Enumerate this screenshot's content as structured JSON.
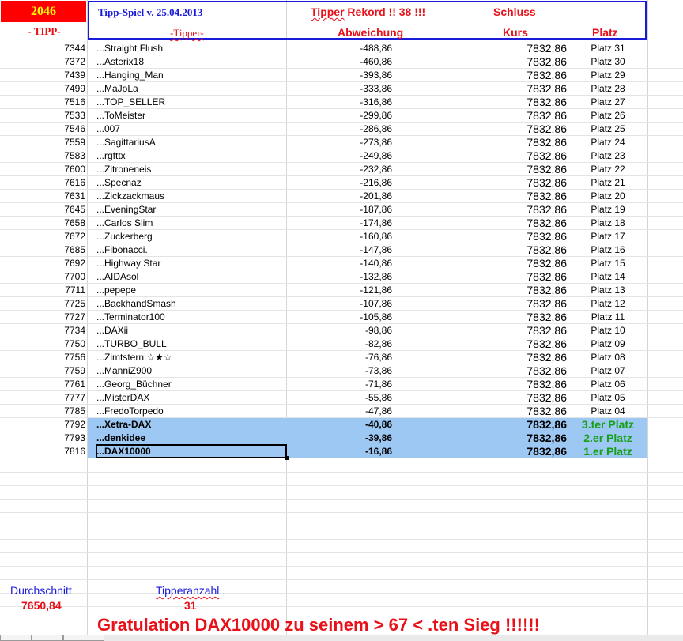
{
  "header": {
    "year": "2046",
    "title": "Tipp-Spiel v. 25.04.2013",
    "rekord_word": "Tipper",
    "rekord_rest": " Rekord !!  38  !!!",
    "schluss": "Schluss",
    "col_tipp": "- TIPP-",
    "col_tipper": "-Tipper-",
    "col_abweichung": "Abweichung",
    "col_kurs": "Kurs",
    "col_platz": "Platz"
  },
  "rows": [
    {
      "tipp": "7344",
      "name": "...Straight Flush",
      "abw": "-488,86",
      "kurs": "7832,86",
      "platz": "Platz 31"
    },
    {
      "tipp": "7372",
      "name": "...Asterix18",
      "abw": "-460,86",
      "kurs": "7832,86",
      "platz": "Platz 30"
    },
    {
      "tipp": "7439",
      "name": "...Hanging_Man",
      "abw": "-393,86",
      "kurs": "7832,86",
      "platz": "Platz 29"
    },
    {
      "tipp": "7499",
      "name": "...MaJoLa",
      "abw": "-333,86",
      "kurs": "7832,86",
      "platz": "Platz 28"
    },
    {
      "tipp": "7516",
      "name": "...TOP_SELLER",
      "abw": "-316,86",
      "kurs": "7832,86",
      "platz": "Platz 27"
    },
    {
      "tipp": "7533",
      "name": "...ToMeister",
      "abw": "-299,86",
      "kurs": "7832,86",
      "platz": "Platz 26"
    },
    {
      "tipp": "7546",
      "name": "...007",
      "abw": "-286,86",
      "kurs": "7832,86",
      "platz": "Platz 25"
    },
    {
      "tipp": "7559",
      "name": "...SagittariusA",
      "abw": "-273,86",
      "kurs": "7832,86",
      "platz": "Platz 24"
    },
    {
      "tipp": "7583",
      "name": "...rgfttx",
      "abw": "-249,86",
      "kurs": "7832,86",
      "platz": "Platz 23"
    },
    {
      "tipp": "7600",
      "name": "...Zitroneneis",
      "abw": "-232,86",
      "kurs": "7832,86",
      "platz": "Platz 22"
    },
    {
      "tipp": "7616",
      "name": "...Specnaz",
      "abw": "-216,86",
      "kurs": "7832,86",
      "platz": "Platz 21"
    },
    {
      "tipp": "7631",
      "name": "...Zickzackmaus",
      "abw": "-201,86",
      "kurs": "7832,86",
      "platz": "Platz 20"
    },
    {
      "tipp": "7645",
      "name": "...EveningStar",
      "abw": "-187,86",
      "kurs": "7832,86",
      "platz": "Platz 19"
    },
    {
      "tipp": "7658",
      "name": "...Carlos Slim",
      "abw": "-174,86",
      "kurs": "7832,86",
      "platz": "Platz 18"
    },
    {
      "tipp": "7672",
      "name": "...Zuckerberg",
      "abw": "-160,86",
      "kurs": "7832,86",
      "platz": "Platz 17"
    },
    {
      "tipp": "7685",
      "name": "...Fibonacci.",
      "abw": "-147,86",
      "kurs": "7832,86",
      "platz": "Platz 16"
    },
    {
      "tipp": "7692",
      "name": "...Highway Star",
      "abw": "-140,86",
      "kurs": "7832,86",
      "platz": "Platz 15"
    },
    {
      "tipp": "7700",
      "name": "...AIDAsol",
      "abw": "-132,86",
      "kurs": "7832,86",
      "platz": "Platz 14"
    },
    {
      "tipp": "7711",
      "name": "...pepepe",
      "abw": "-121,86",
      "kurs": "7832,86",
      "platz": "Platz 13"
    },
    {
      "tipp": "7725",
      "name": "...BackhandSmash",
      "abw": "-107,86",
      "kurs": "7832,86",
      "platz": "Platz 12"
    },
    {
      "tipp": "7727",
      "name": "...Terminator100",
      "abw": "-105,86",
      "kurs": "7832,86",
      "platz": "Platz 11"
    },
    {
      "tipp": "7734",
      "name": "...DAXii",
      "abw": "-98,86",
      "kurs": "7832,86",
      "platz": "Platz 10"
    },
    {
      "tipp": "7750",
      "name": "...TURBO_BULL",
      "abw": "-82,86",
      "kurs": "7832,86",
      "platz": "Platz 09"
    },
    {
      "tipp": "7756",
      "name": "...Zimtstern ☆★☆",
      "abw": "-76,86",
      "kurs": "7832,86",
      "platz": "Platz 08"
    },
    {
      "tipp": "7759",
      "name": "...ManniZ900",
      "abw": "-73,86",
      "kurs": "7832,86",
      "platz": "Platz 07"
    },
    {
      "tipp": "7761",
      "name": "...Georg_Büchner",
      "abw": "-71,86",
      "kurs": "7832,86",
      "platz": "Platz 06"
    },
    {
      "tipp": "7777",
      "name": "...MisterDAX",
      "abw": "-55,86",
      "kurs": "7832,86",
      "platz": "Platz 05"
    },
    {
      "tipp": "7785",
      "name": "...FredoTorpedo",
      "abw": "-47,86",
      "kurs": "7832,86",
      "platz": "Platz 04"
    },
    {
      "tipp": "7792",
      "name": "...Xetra-DAX",
      "abw": "-40,86",
      "kurs": "7832,86",
      "platz": "3.ter Platz",
      "highlight": true
    },
    {
      "tipp": "7793",
      "name": "...denkidee",
      "abw": "-39,86",
      "kurs": "7832,86",
      "platz": "2.er Platz",
      "highlight": true
    },
    {
      "tipp": "7816",
      "name": "...DAX10000",
      "abw": "-16,86",
      "kurs": "7832,86",
      "platz": "1.er Platz",
      "highlight": true
    }
  ],
  "footer": {
    "durchschnitt_label": "Durchschnitt",
    "durchschnitt_value": "7650,84",
    "tipperanzahl_label": "Tipperanzahl",
    "tipperanzahl_value": "31",
    "gratulation": "Gratulation DAX10000   zu seinem > 67 < .ten Sieg !!!!!!"
  },
  "colors": {
    "header_blue": "#1a1adb",
    "header_red": "#e8111a",
    "year_bg": "#ff0000",
    "year_fg": "#ffff00",
    "highlight_bg": "#9ec8f4",
    "winner_green": "#16a016"
  }
}
